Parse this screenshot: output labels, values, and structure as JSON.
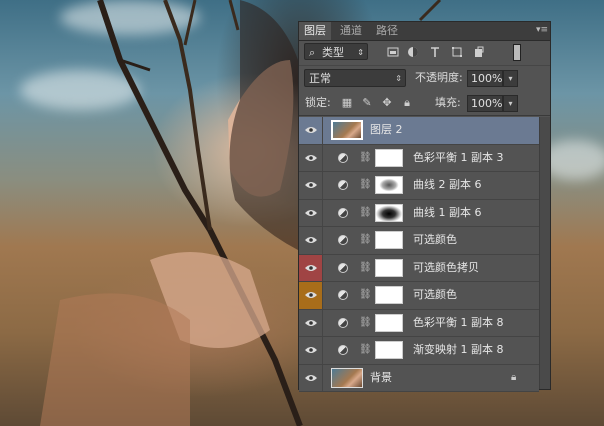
{
  "panel": {
    "tabs": [
      {
        "label": "图层",
        "active": true
      },
      {
        "label": "通道",
        "active": false
      },
      {
        "label": "路径",
        "active": false
      }
    ],
    "filter": {
      "label": "类型"
    },
    "filter_icons": [
      "image-filter-icon",
      "adjustment-filter-icon",
      "type-filter-icon",
      "shape-filter-icon",
      "smart-object-filter-icon"
    ],
    "blend_mode": "正常",
    "opacity_label": "不透明度:",
    "opacity_value": "100%",
    "lock_label": "锁定:",
    "fill_label": "填充:",
    "fill_value": "100%",
    "layers": [
      {
        "name": "图层 2",
        "selected": true
      },
      {
        "name": "色彩平衡 1 副本 3"
      },
      {
        "name": "曲线 2 副本 6"
      },
      {
        "name": "曲线 1 副本 6"
      },
      {
        "name": "可选颜色"
      },
      {
        "name": "可选颜色拷贝",
        "label_color": "#a04444"
      },
      {
        "name": "可选颜色",
        "label_color": "#a86d1a"
      },
      {
        "name": "色彩平衡 1 副本 8"
      },
      {
        "name": "渐变映射 1 副本 8"
      },
      {
        "name": "背景",
        "locked": true
      }
    ]
  }
}
